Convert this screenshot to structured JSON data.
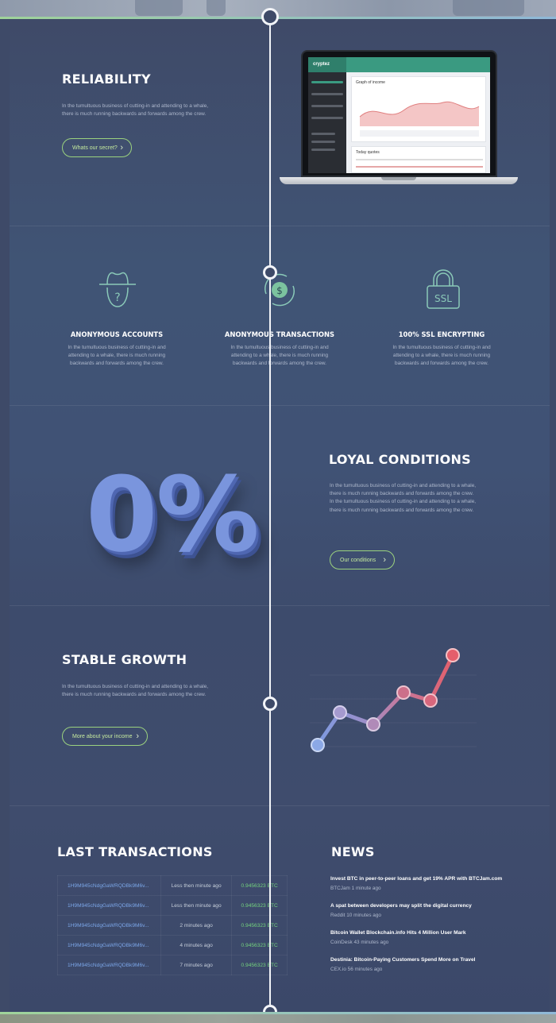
{
  "reliability": {
    "title": "RELIABILITY",
    "text": "In the tumultuous business of cutting-in and attending to a whale, there is much running backwards and forwards among the crew.",
    "button": "Whats our secret?"
  },
  "laptop_screen": {
    "logo": "cryptez",
    "card_title": "Graph of income",
    "quotes_title": "Today quotes"
  },
  "features": [
    {
      "icon": "anonymous-hat-icon",
      "title": "ANONYMOUS ACCOUNTS",
      "text": "In the tumultuous business of cutting-in and attending to a whale, there is much running backwards and forwards among the crew."
    },
    {
      "icon": "dollar-cycle-icon",
      "title": "ANONYMOUS TRANSACTIONS",
      "text": "In the tumultuous business of cutting-in and attending to a whale, there is much running backwards and forwards among the crew."
    },
    {
      "icon": "ssl-lock-icon",
      "title": "100% SSL ENCRYPTING",
      "text": "In the tumultuous business of cutting-in and attending to a whale, there is much running backwards and forwards among the crew."
    }
  ],
  "loyal": {
    "big": "0%",
    "title": "LOYAL CONDITIONS",
    "text": "In the tumultuous business of cutting-in and attending to a whale, there is much running backwards and forwards among the crew.  In the tumultuous business of cutting-in and attending to a whale, there is much running backwards and forwards among the crew.",
    "button": "Our conditions"
  },
  "growth": {
    "title": "STABLE GROWTH",
    "text": "In the tumultuous business of cutting-in and attending to a whale, there is much running backwards and forwards among the crew.",
    "button": "More about your income"
  },
  "transactions": {
    "title": "LAST TRANSACTIONS",
    "rows": [
      {
        "address": "1H9M945cNdgGaWRQDBk9M6v...",
        "time": "Less then minute ago",
        "amount": "0.9456323 BTC"
      },
      {
        "address": "1H9M945cNdgGaWRQDBk9M6v...",
        "time": "Less then minute ago",
        "amount": "0.9456323 BTC"
      },
      {
        "address": "1H9M945cNdgGaWRQDBk9M6v...",
        "time": "2 minutes ago",
        "amount": "0.9456323 BTC"
      },
      {
        "address": "1H9M945cNdgGaWRQDBk9M6v...",
        "time": "4 minutes ago",
        "amount": "0.9456323 BTC"
      },
      {
        "address": "1H9M945cNdgGaWRQDBk9M6v...",
        "time": "7 minutes ago",
        "amount": "0.9456323 BTC"
      }
    ]
  },
  "news": {
    "title": "NEWS",
    "items": [
      {
        "headline": "Invest BTC in peer-to-peer loans and get 19% APR with BTCJam.com",
        "meta": "BTCJam 1 minute ago"
      },
      {
        "headline": "A spat between developers may split the digital currency",
        "meta": "Reddit 10 minutes ago"
      },
      {
        "headline": "Bitcoin Wallet Blockchain.info Hits 4 Million User Mark",
        "meta": "CoinDesk 43 minutes ago"
      },
      {
        "headline": "Destinia: Bitcoin-Paying Customers Spend More on Travel",
        "meta": "CEX.io 56 minutes ago"
      }
    ]
  },
  "colors": {
    "accent_green": "#9bd27f",
    "link_blue": "#7ba6e8",
    "amount_green": "#74d27e",
    "panel": "#3f4c6d"
  }
}
